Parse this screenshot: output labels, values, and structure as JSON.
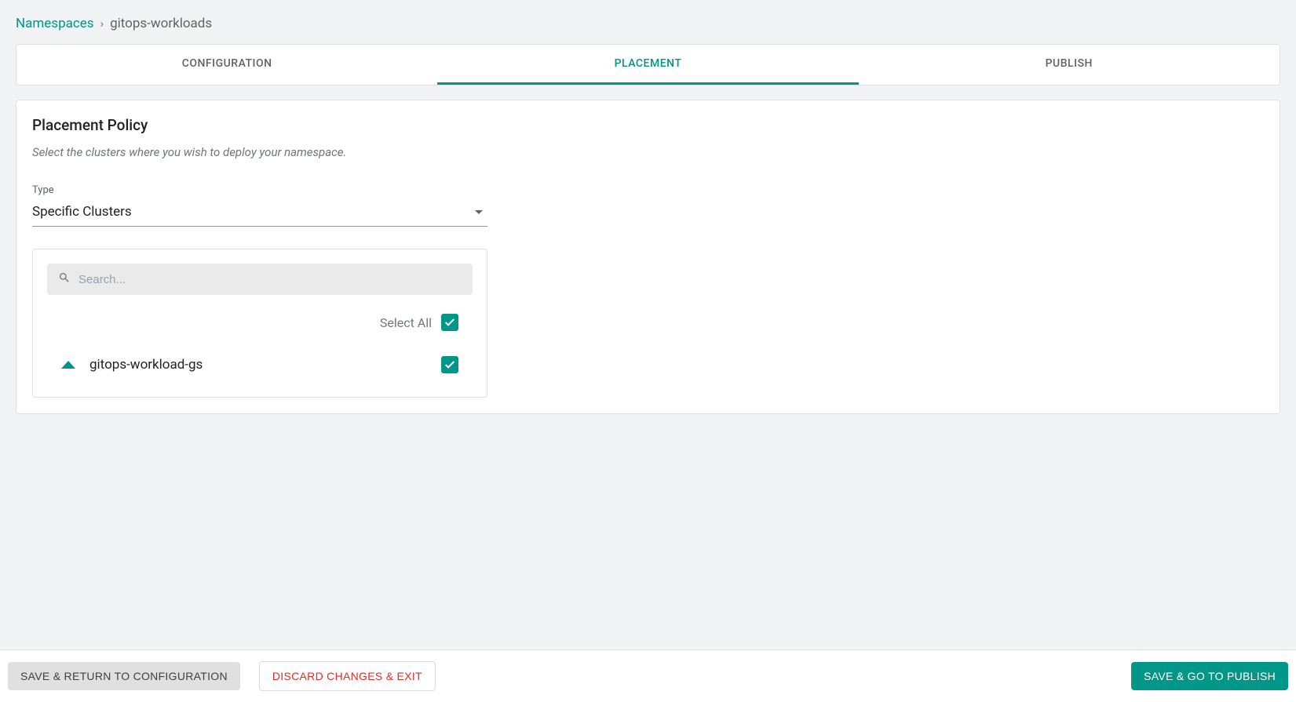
{
  "breadcrumb": {
    "root_label": "Namespaces",
    "separator": "›",
    "current": "gitops-workloads"
  },
  "tabs": {
    "configuration": "CONFIGURATION",
    "placement": "PLACEMENT",
    "publish": "PUBLISH"
  },
  "placement": {
    "title": "Placement Policy",
    "subtitle": "Select the clusters where you wish to deploy your namespace.",
    "type_label": "Type",
    "type_value": "Specific Clusters"
  },
  "clusters": {
    "search_placeholder": "Search...",
    "select_all_label": "Select All",
    "items": [
      {
        "name": "gitops-workload-gs"
      }
    ]
  },
  "footer": {
    "save_return": "SAVE & RETURN TO CONFIGURATION",
    "discard": "DISCARD CHANGES & EXIT",
    "save_go": "SAVE & GO TO PUBLISH"
  }
}
